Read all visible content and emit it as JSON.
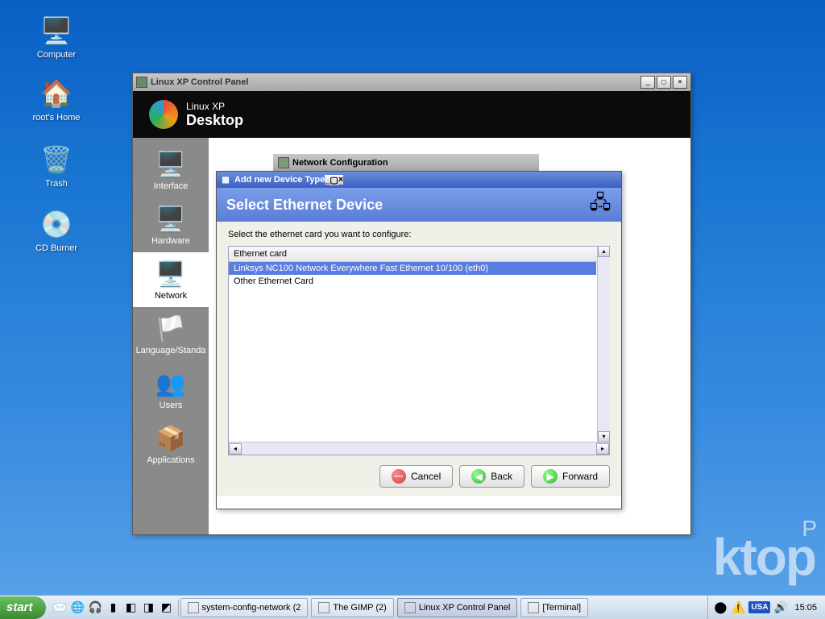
{
  "desktop_icons": [
    {
      "label": "Computer",
      "glyph": "🖥️"
    },
    {
      "label": "root's Home",
      "glyph": "🏠"
    },
    {
      "label": "Trash",
      "glyph": "🗑️"
    },
    {
      "label": "CD Burner",
      "glyph": "💿"
    }
  ],
  "watermark": {
    "small": "P",
    "large": "ktop"
  },
  "control_panel": {
    "title": "Linux XP Control Panel",
    "logo_line1": "Linux XP",
    "logo_line2": "Desktop",
    "sidebar": [
      {
        "label": "Interface",
        "glyph": "🖥️",
        "selected": false
      },
      {
        "label": "Hardware",
        "glyph": "🖥️",
        "selected": false
      },
      {
        "label": "Network",
        "glyph": "🖥️",
        "selected": true
      },
      {
        "label": "Language/Standa",
        "glyph": "🏳️",
        "selected": false
      },
      {
        "label": "Users",
        "glyph": "👥",
        "selected": false
      },
      {
        "label": "Applications",
        "glyph": "📦",
        "selected": false
      }
    ]
  },
  "netcfg": {
    "title": "Network Configuration"
  },
  "dialog": {
    "title": "Add new Device Type",
    "banner": "Select Ethernet Device",
    "instruction": "Select the ethernet card you want to configure:",
    "list_header": "Ethernet card",
    "rows": [
      {
        "text": "Linksys NC100 Network Everywhere Fast Ethernet 10/100 (eth0)",
        "selected": true
      },
      {
        "text": "Other Ethernet Card",
        "selected": false
      }
    ],
    "buttons": {
      "cancel": "Cancel",
      "back": "Back",
      "forward": "Forward"
    }
  },
  "taskbar": {
    "start": "start",
    "tasks": [
      {
        "label": "system-config-network (2",
        "active": false
      },
      {
        "label": "The GIMP (2)",
        "active": false
      },
      {
        "label": "Linux XP Control Panel",
        "active": true
      },
      {
        "label": "[Terminal]",
        "active": false
      }
    ],
    "lang": "USA",
    "clock": "15:05"
  }
}
